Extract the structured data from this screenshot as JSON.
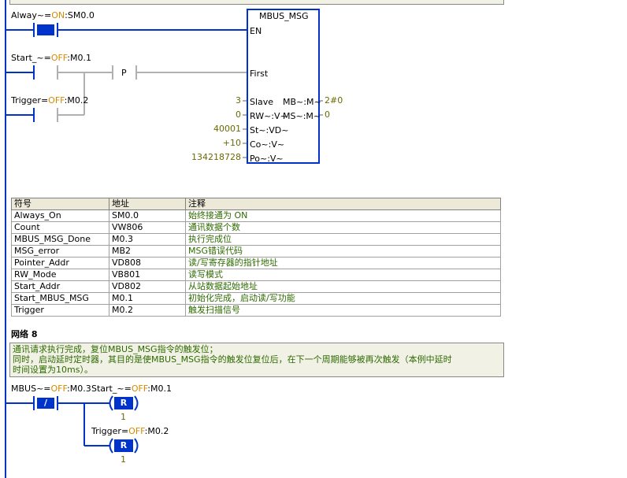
{
  "network7": {
    "contacts": [
      {
        "name": "Alway",
        "state": "ON",
        "addr": "SM0.0"
      },
      {
        "name": "Start_",
        "state": "OFF",
        "addr": "M0.1"
      },
      {
        "name": "Trigger",
        "state": "OFF",
        "addr": "M0.2"
      }
    ],
    "edge_label": "P",
    "block": {
      "title": "MBUS_MSG",
      "en": "EN",
      "first": "First",
      "inputs": [
        {
          "value": "3",
          "pin": "Slave"
        },
        {
          "value": "0",
          "pin": "RW~:V~"
        },
        {
          "value": "40001",
          "pin": "St~:VD~"
        },
        {
          "value": "+10",
          "pin": "Co~:V~"
        },
        {
          "value": "134218728",
          "pin": "Po~:V~"
        }
      ],
      "outputs": [
        {
          "pin": "MB~:M~",
          "value": "2#0"
        },
        {
          "pin": "MS~:M~",
          "value": "0"
        }
      ]
    }
  },
  "symbol_table": {
    "headers": [
      "符号",
      "地址",
      "注释"
    ],
    "rows": [
      [
        "Always_On",
        "SM0.0",
        "始终接通为 ON"
      ],
      [
        "Count",
        "VW806",
        "通讯数据个数"
      ],
      [
        "MBUS_MSG_Done",
        "M0.3",
        "执行完成位"
      ],
      [
        "MSG_error",
        "MB2",
        "MSG错误代码"
      ],
      [
        "Pointer_Addr",
        "VD808",
        "读/写寄存器的指针地址"
      ],
      [
        "RW_Mode",
        "VB801",
        "读写模式"
      ],
      [
        "Start_Addr",
        "VD802",
        "从站数据起始地址"
      ],
      [
        "Start_MBUS_MSG",
        "M0.1",
        "初始化完成，启动读/写功能"
      ],
      [
        "Trigger",
        "M0.2",
        "触发扫描信号"
      ]
    ]
  },
  "network8": {
    "title": "网络 8",
    "comment_lines": [
      "通讯请求执行完成，复位MBUS_MSG指令的触发位；",
      "同时，启动延时定时器，其目的是使MBUS_MSG指令的触发位复位后，在下一个周期能够被再次触发（本例中延时",
      "时间设置为10ms）。"
    ],
    "contact": {
      "name": "MBUS",
      "state": "OFF",
      "addr": "M0.3",
      "symbol": "/"
    },
    "coils": [
      {
        "name": "Start_",
        "state": "OFF",
        "addr": "M0.1",
        "symbol": "R",
        "count": "1"
      },
      {
        "name": "Trigger",
        "state": "OFF",
        "addr": "M0.2",
        "symbol": "R",
        "count": "1"
      }
    ]
  },
  "colors": {
    "rail": "#0033cc",
    "wire_active": "#0033cc",
    "wire_inactive": "#b0b0b0",
    "comment_text": "#2e6b00",
    "state_text": "#d68a00"
  }
}
